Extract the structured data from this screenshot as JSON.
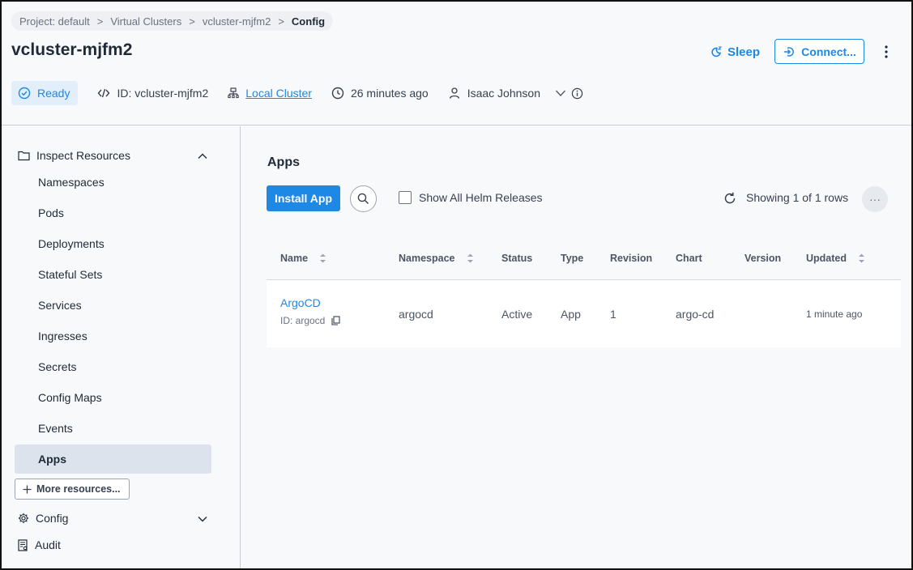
{
  "breadcrumb": {
    "items": [
      "Project: default",
      "Virtual Clusters",
      "vcluster-mjfm2"
    ],
    "current": "Config",
    "separator": ">"
  },
  "header": {
    "title": "vcluster-mjfm2",
    "sleep_label": "Sleep",
    "connect_label": "Connect...",
    "status": "Ready",
    "id_text": "ID: vcluster-mjfm2",
    "cluster_link": "Local Cluster",
    "age": "26 minutes ago",
    "owner": "Isaac Johnson"
  },
  "sidebar": {
    "inspect_label": "Inspect Resources",
    "items": [
      "Namespaces",
      "Pods",
      "Deployments",
      "Stateful Sets",
      "Services",
      "Ingresses",
      "Secrets",
      "Config Maps",
      "Events",
      "Apps"
    ],
    "active": "Apps",
    "more_label": "More resources...",
    "config_label": "Config",
    "audit_label": "Audit"
  },
  "main": {
    "title": "Apps",
    "install_label": "Install App",
    "show_helm_label": "Show All Helm Releases",
    "showing_text": "Showing 1 of 1 rows",
    "dots": "···",
    "columns": [
      "Name",
      "Namespace",
      "Status",
      "Type",
      "Revision",
      "Chart",
      "Version",
      "Updated"
    ],
    "rows": [
      {
        "name": "ArgoCD",
        "id": "ID: argocd",
        "namespace": "argocd",
        "status": "Active",
        "type": "App",
        "revision": "1",
        "chart": "argo-cd",
        "version": "",
        "updated": "1 minute ago"
      }
    ]
  },
  "colors": {
    "accent": "#1e88e5",
    "active_bg": "#dde3ec",
    "ready_bg": "#e3eefb"
  }
}
